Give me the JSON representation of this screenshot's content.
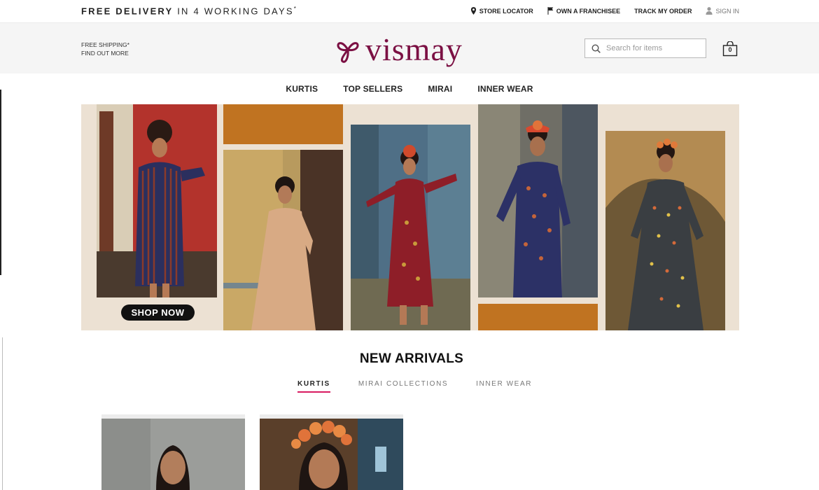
{
  "topbar": {
    "promo_bold": "FREE DELIVERY",
    "promo_light": "IN 4 WORKING DAYS",
    "promo_mark": "*",
    "links": [
      {
        "label": "STORE LOCATOR",
        "icon": "map-pin-icon"
      },
      {
        "label": "OWN A FRANCHISEE",
        "icon": "flag-icon"
      },
      {
        "label": "TRACK MY ORDER",
        "icon": ""
      },
      {
        "label": "SIGN IN",
        "icon": "user-icon"
      }
    ]
  },
  "header": {
    "shipping_line1": "FREE SHIPPING*",
    "shipping_line2": "FIND OUT MORE",
    "logo_text": "vismay",
    "search_placeholder": "Search for items",
    "cart_count": "0",
    "brand_color": "#7b1043"
  },
  "nav": {
    "items": [
      "KURTIS",
      "TOP SELLERS",
      "MIRAI",
      "INNER WEAR"
    ]
  },
  "banner": {
    "cta_label": "SHOP NOW",
    "background_color": "#ece1d3",
    "accent_color": "#c07321"
  },
  "new_arrivals": {
    "title": "NEW ARRIVALS",
    "tabs": [
      "KURTIS",
      "MIRAI COLLECTIONS",
      "INNER WEAR"
    ],
    "active_tab": "KURTIS",
    "tab_underline_color": "#d81b60"
  }
}
